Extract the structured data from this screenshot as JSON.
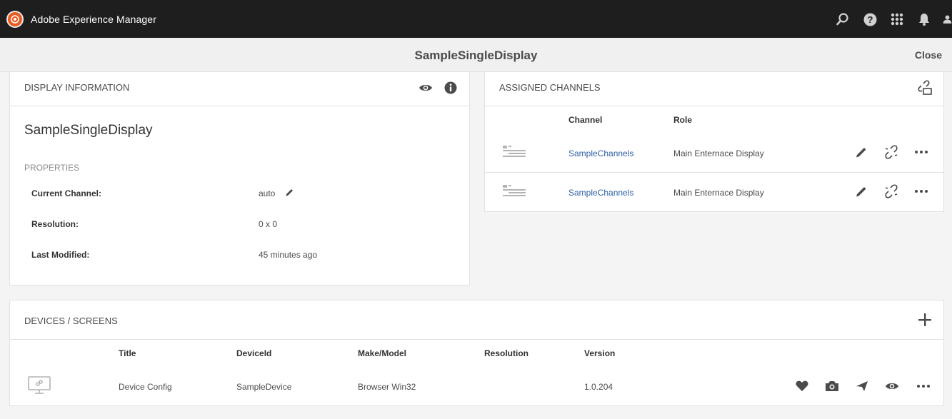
{
  "shell": {
    "app_title": "Adobe Experience Manager",
    "icons": [
      "search-icon",
      "help-icon",
      "apps-grid-icon",
      "notifications-icon",
      "user-icon"
    ]
  },
  "titlebar": {
    "title": "SampleSingleDisplay",
    "close_label": "Close"
  },
  "display_info": {
    "header": "DISPLAY INFORMATION",
    "name": "SampleSingleDisplay",
    "properties_label": "PROPERTIES",
    "properties": [
      {
        "key": "Current Channel:",
        "value": "auto"
      },
      {
        "key": "Resolution:",
        "value": "0 x 0"
      },
      {
        "key": "Last Modified:",
        "value": "45 minutes ago"
      }
    ]
  },
  "assigned_channels": {
    "header": "ASSIGNED CHANNELS",
    "columns": [
      "Channel",
      "Role"
    ],
    "rows": [
      {
        "channel": "SampleChannels",
        "role": "Main Enternace Display"
      },
      {
        "channel": "SampleChannels",
        "role": "Main Enternace Display"
      }
    ]
  },
  "devices": {
    "header": "DEVICES / SCREENS",
    "columns": [
      "Title",
      "DeviceId",
      "Make/Model",
      "Resolution",
      "Version"
    ],
    "rows": [
      {
        "title": "Device Config",
        "device_id": "SampleDevice",
        "make_model": "Browser Win32",
        "resolution": "",
        "version": "1.0.204"
      }
    ]
  },
  "colors": {
    "shell_bg": "#1e1e1e",
    "brand": "#eb5a1e",
    "link": "#2d5fa6"
  }
}
